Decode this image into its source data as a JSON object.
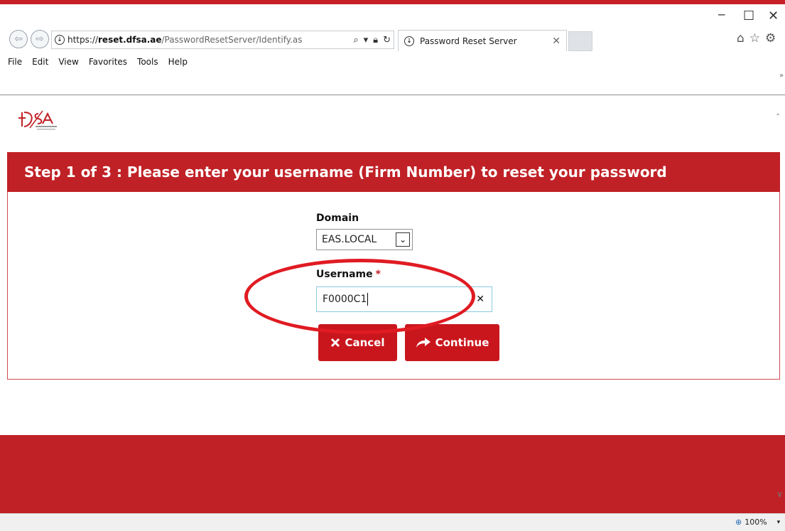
{
  "window": {
    "minimize_icon": "minimize-icon",
    "maximize_icon": "maximize-icon",
    "close_icon": "close-icon"
  },
  "browser": {
    "url_scheme": "https://",
    "url_host": "reset.dfsa.ae",
    "url_path": "/PasswordResetServer/Identify.as",
    "tab_title": "Password Reset Server",
    "menu": [
      "File",
      "Edit",
      "View",
      "Favorites",
      "Tools",
      "Help"
    ],
    "zoom": "100%"
  },
  "page": {
    "banner_text": "Step 1 of 3 : Please enter your username (Firm Number) to reset your password",
    "domain_label": "Domain",
    "domain_value": "EAS.LOCAL",
    "username_label": "Username",
    "required_mark": "*",
    "username_value": "F0000C1",
    "cancel_label": "Cancel",
    "continue_label": "Continue"
  },
  "colors": {
    "brand_red": "#c02126",
    "button_red": "#c9161d",
    "annotation_red": "#e01b22",
    "input_focus": "#8cc9e0"
  }
}
